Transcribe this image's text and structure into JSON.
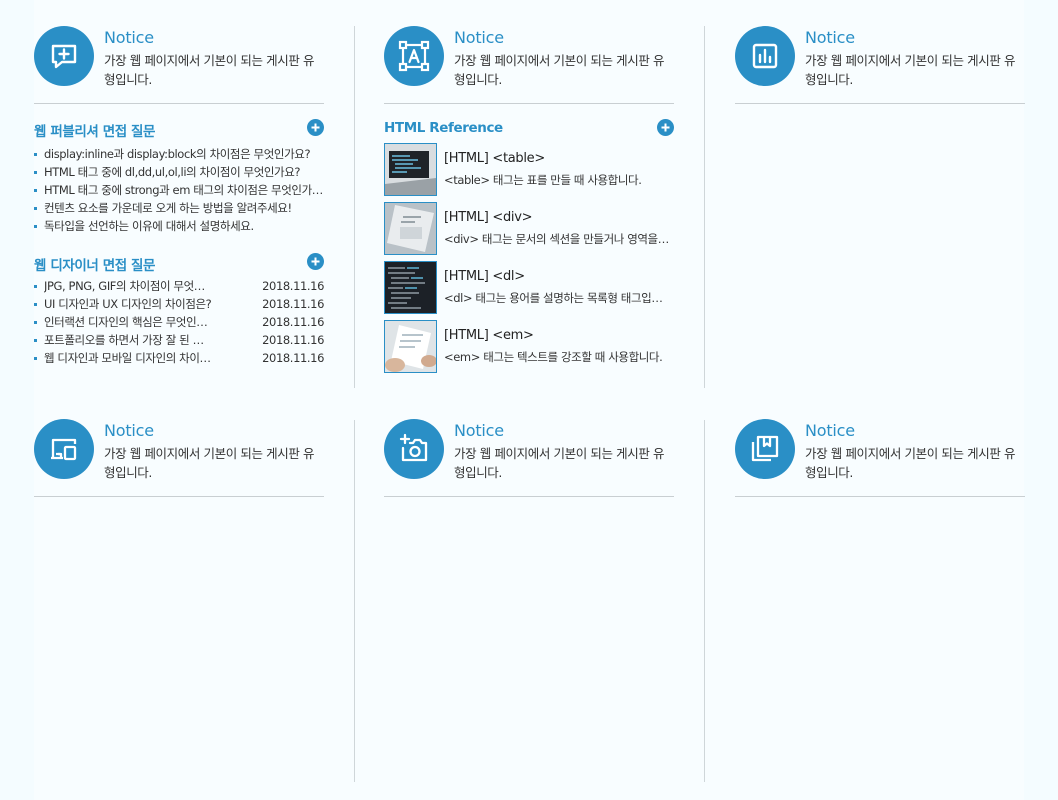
{
  "cards": [
    {
      "title": "Notice",
      "desc": "가장 웹 페이지에서 기본이 되는 게시판 유형입니다.",
      "icon": "message-plus-icon"
    },
    {
      "title": "Notice",
      "desc": "가장 웹 페이지에서 기본이 되는 게시판 유형입니다.",
      "icon": "text-select-icon"
    },
    {
      "title": "Notice",
      "desc": "가장 웹 페이지에서 기본이 되는 게시판 유형입니다.",
      "icon": "bar-chart-icon"
    },
    {
      "title": "Notice",
      "desc": "가장 웹 페이지에서 기본이 되는 게시판 유형입니다.",
      "icon": "devices-icon"
    },
    {
      "title": "Notice",
      "desc": "가장 웹 페이지에서 기본이 되는 게시판 유형입니다.",
      "icon": "camera-plus-icon"
    },
    {
      "title": "Notice",
      "desc": "가장 웹 페이지에서 기본이 되는 게시판 유형입니다.",
      "icon": "bookmark-book-icon"
    }
  ],
  "publisher": {
    "title": "웹 퍼블리셔 면접 질문",
    "items": [
      "display:inline과 display:block의 차이점은 무엇인가요?",
      "HTML 태그 중에 dl,dd,ul,ol,li의 차이점이 무엇인가요?",
      "HTML 태그 중에 strong과 em 태그의 차이점은 무엇인가요?",
      "컨텐츠 요소를 가운데로 오게 하는 방법을 알려주세요!",
      "독타입을 선언하는 이유에 대해서 설명하세요."
    ]
  },
  "designer": {
    "title": "웹 디자이너 면접 질문",
    "items": [
      {
        "title": "JPG, PNG, GIF의 차이점이 무엇인가요?",
        "date": "2018.11.16"
      },
      {
        "title": "UI 디자인과 UX 디자인의 차이점은?",
        "date": "2018.11.16"
      },
      {
        "title": "인터랙션 디자인의 핵심은 무엇인가요?",
        "date": "2018.11.16"
      },
      {
        "title": "포트폴리오를 하면서 가장 잘 된 점은?",
        "date": "2018.11.16"
      },
      {
        "title": "웹 디자인과 모바일 디자인의 차이점은?",
        "date": "2018.11.16"
      }
    ]
  },
  "reference": {
    "title": "HTML Reference",
    "items": [
      {
        "title": "[HTML] <table>",
        "desc": "<table> 태그는 표를 만들 때 사용합니다."
      },
      {
        "title": "[HTML] <div>",
        "desc": "<div> 태그는 문서의 섹션을 만들거나 영역을 구분할 때 사용합니다."
      },
      {
        "title": "[HTML] <dl>",
        "desc": "<dl> 태그는 용어를 설명하는 목록형 태그입니다."
      },
      {
        "title": "[HTML] <em>",
        "desc": "<em> 태그는 텍스트를 강조할 때 사용합니다."
      }
    ]
  },
  "colors": {
    "accent": "#2a8fc6",
    "background": "#f4fcff",
    "divider": "#c9cfd2"
  }
}
